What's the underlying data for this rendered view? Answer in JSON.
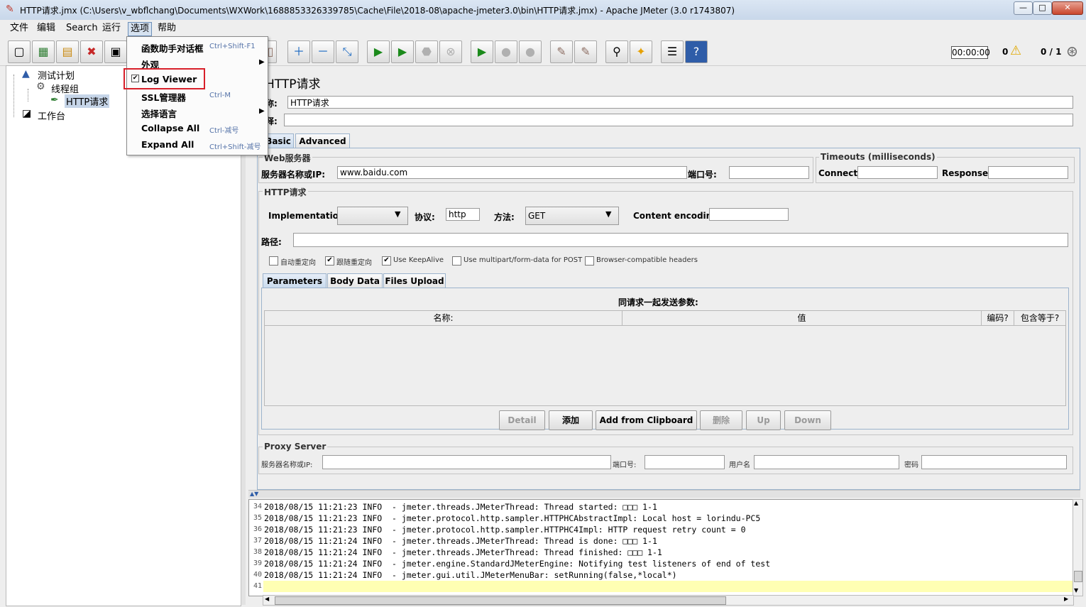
{
  "window": {
    "title": "HTTP请求.jmx (C:\\Users\\v_wbflchang\\Documents\\WXWork\\1688853326339785\\Cache\\File\\2018-08\\apache-jmeter3.0\\bin\\HTTP请求.jmx) - Apache JMeter (3.0 r1743807)",
    "minimize": "—",
    "maximize": "□",
    "close": "✕"
  },
  "menubar": [
    "文件",
    "编辑",
    "Search",
    "运行",
    "选项",
    "帮助"
  ],
  "options_menu": [
    {
      "label": "函数助手对话框",
      "shortcut": "Ctrl+Shift-F1"
    },
    {
      "label": "外观",
      "submenu": "▶"
    },
    {
      "label": "Log Viewer",
      "checked": "✔"
    },
    {
      "label": "SSL管理器",
      "shortcut": "Ctrl-M"
    },
    {
      "label": "选择语言",
      "submenu": "▶"
    },
    {
      "label": "Collapse All",
      "shortcut": "Ctrl-减号"
    },
    {
      "label": "Expand All",
      "shortcut": "Ctrl+Shift-减号"
    }
  ],
  "toolbar": {
    "timer": "00:00:00",
    "warnings": "0",
    "threads": "0 / 1"
  },
  "tree": {
    "test_plan": "测试计划",
    "thread_group": "线程组",
    "http_request": "HTTP请求",
    "workbench": "工作台"
  },
  "panel": {
    "title": "HTTP请求",
    "name_label": "称:",
    "name_value": "HTTP请求",
    "comment_label": "释:",
    "tabs": [
      "Basic",
      "Advanced"
    ],
    "web_server": {
      "group": "Web服务器",
      "server_label": "服务器名称或IP:",
      "server_value": "www.baidu.com",
      "port_label": "端口号:"
    },
    "timeouts": {
      "group": "Timeouts (milliseconds)",
      "connect_label": "Connect:",
      "response_label": "Response:"
    },
    "http": {
      "group": "HTTP请求",
      "impl_label": "Implementation:",
      "protocol_label": "协议:",
      "protocol_value": "http",
      "method_label": "方法:",
      "method_value": "GET",
      "encoding_label": "Content encoding:",
      "path_label": "路径:"
    },
    "options": [
      {
        "label": "自动重定向",
        "checked": ""
      },
      {
        "label": "跟随重定向",
        "checked": "✔"
      },
      {
        "label": "Use KeepAlive",
        "checked": "✔"
      },
      {
        "label": "Use multipart/form-data for POST",
        "checked": ""
      },
      {
        "label": "Browser-compatible headers",
        "checked": ""
      }
    ],
    "param_tabs": [
      "Parameters",
      "Body Data",
      "Files Upload"
    ],
    "params_title": "同请求一起发送参数:",
    "columns": [
      "名称:",
      "值",
      "编码?",
      "包含等于?"
    ],
    "buttons": [
      "Detail",
      "添加",
      "Add from Clipboard",
      "删除",
      "Up",
      "Down"
    ],
    "proxy": {
      "group": "Proxy Server",
      "server_label": "服务器名称或IP:",
      "port_label": "端口号:",
      "user_label": "用户名",
      "pass_label": "密码"
    }
  },
  "log": [
    {
      "n": "34",
      "text": "2018/08/15 11:21:23 INFO  - jmeter.threads.JMeterThread: Thread started: □□□ 1-1"
    },
    {
      "n": "35",
      "text": "2018/08/15 11:21:23 INFO  - jmeter.protocol.http.sampler.HTTPHCAbstractImpl: Local host = lorindu-PC5"
    },
    {
      "n": "36",
      "text": "2018/08/15 11:21:23 INFO  - jmeter.protocol.http.sampler.HTTPHC4Impl: HTTP request retry count = 0"
    },
    {
      "n": "37",
      "text": "2018/08/15 11:21:24 INFO  - jmeter.threads.JMeterThread: Thread is done: □□□ 1-1"
    },
    {
      "n": "38",
      "text": "2018/08/15 11:21:24 INFO  - jmeter.threads.JMeterThread: Thread finished: □□□ 1-1"
    },
    {
      "n": "39",
      "text": "2018/08/15 11:21:24 INFO  - jmeter.engine.StandardJMeterEngine: Notifying test listeners of end of test"
    },
    {
      "n": "40",
      "text": "2018/08/15 11:21:24 INFO  - jmeter.gui.util.JMeterMenuBar: setRunning(false,*local*)"
    },
    {
      "n": "41",
      "text": ""
    }
  ]
}
